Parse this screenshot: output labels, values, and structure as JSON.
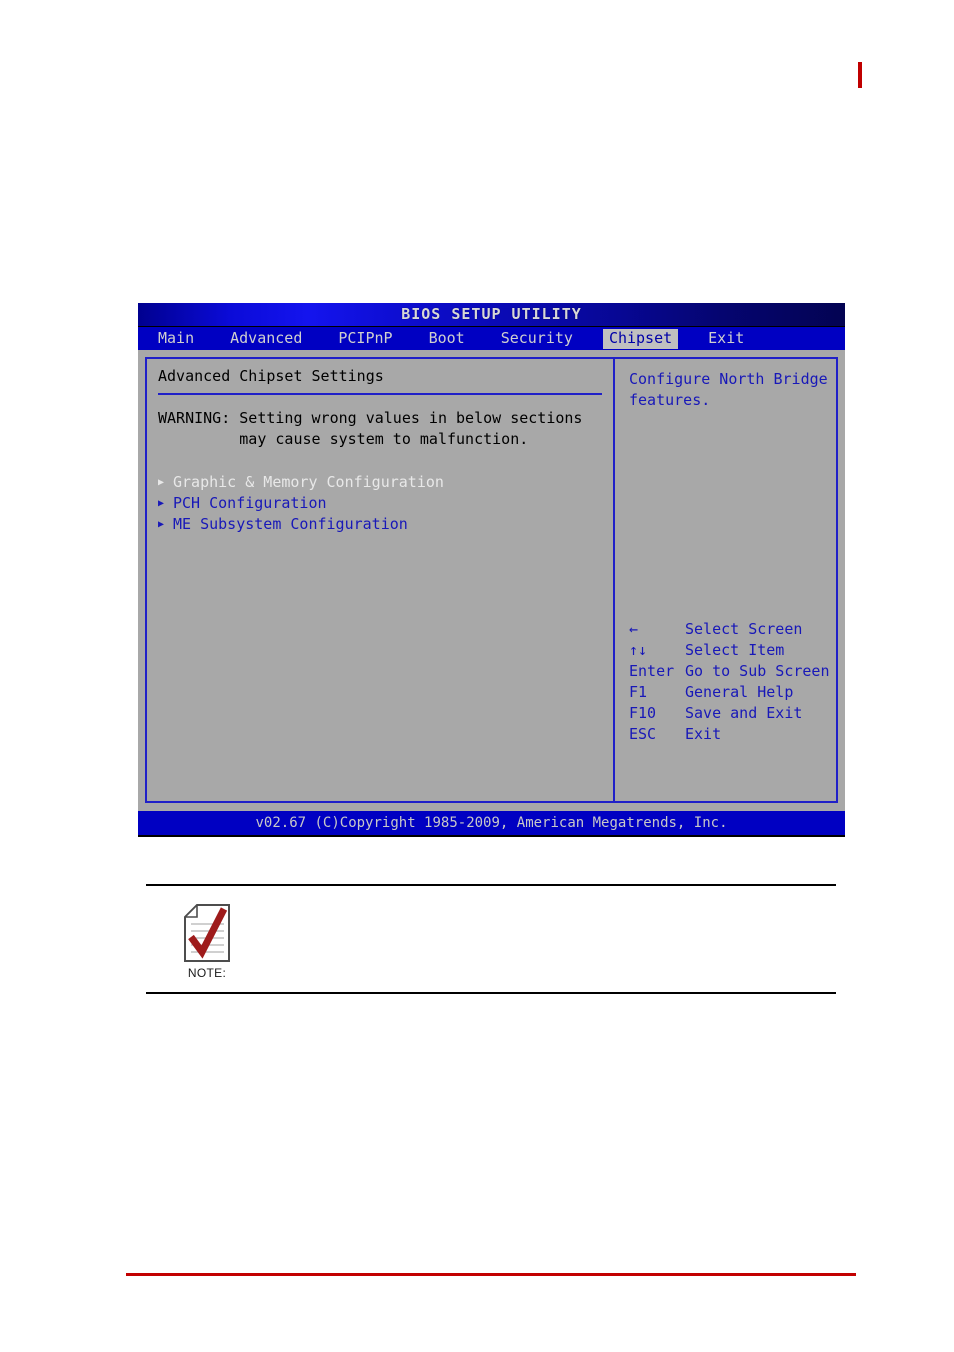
{
  "page": {
    "top_marker_color": "#c00000",
    "bottom_rule_color": "#c20000"
  },
  "bios": {
    "title": "BIOS SETUP UTILITY",
    "menu": [
      {
        "label": "Main",
        "active": false
      },
      {
        "label": "Advanced",
        "active": false
      },
      {
        "label": "PCIPnP",
        "active": false
      },
      {
        "label": "Boot",
        "active": false
      },
      {
        "label": "Security",
        "active": false
      },
      {
        "label": "Chipset",
        "active": true
      },
      {
        "label": "Exit",
        "active": false
      }
    ],
    "left_panel": {
      "heading": "Advanced Chipset Settings",
      "warning_line1": "WARNING: Setting wrong values in below sections",
      "warning_line2": "         may cause system to malfunction.",
      "items": [
        {
          "arrow": "▶",
          "label": "Graphic & Memory Configuration",
          "state": "selected"
        },
        {
          "arrow": "▶",
          "label": "PCH Configuration",
          "state": "normal"
        },
        {
          "arrow": "▶",
          "label": "ME Subsystem Configuration",
          "state": "normal"
        }
      ]
    },
    "right_panel": {
      "help_line1": "Configure North Bridge",
      "help_line2": "features.",
      "keys": [
        {
          "key": "←",
          "desc": "Select Screen"
        },
        {
          "key": "↑↓",
          "desc": "Select Item"
        },
        {
          "key": "Enter",
          "desc": "Go to Sub Screen"
        },
        {
          "key": "F1",
          "desc": "General Help"
        },
        {
          "key": "F10",
          "desc": "Save and Exit"
        },
        {
          "key": "ESC",
          "desc": "Exit"
        }
      ]
    },
    "footer": "v02.67 (C)Copyright 1985-2009, American Megatrends, Inc.",
    "colors": {
      "menubar_blue": "#0000c2",
      "body_gray": "#a8a8a8",
      "border_blue": "#2020c8",
      "text_blue": "#1818b8",
      "selected_white": "#e8e8e8",
      "tab_active_bg": "#c0c0c0"
    }
  },
  "note": {
    "label": "NOTE:",
    "icon": "note-document-check-icon",
    "check_color": "#9e1b1b",
    "body": ""
  }
}
